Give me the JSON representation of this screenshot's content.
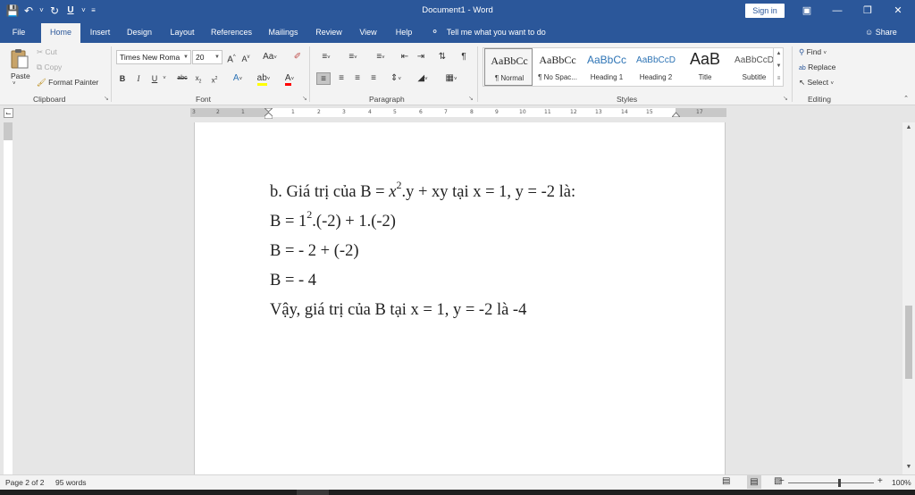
{
  "window": {
    "title": "Document1 - Word",
    "sign_in": "Sign in"
  },
  "tabs": [
    "File",
    "Home",
    "Insert",
    "Design",
    "Layout",
    "References",
    "Mailings",
    "Review",
    "View",
    "Help"
  ],
  "tell_me": "Tell me what you want to do",
  "share": "Share",
  "clipboard": {
    "paste": "Paste",
    "cut": "Cut",
    "copy": "Copy",
    "format_painter": "Format Painter",
    "label": "Clipboard"
  },
  "font": {
    "family": "Times New Roma",
    "size": "20",
    "label": "Font"
  },
  "paragraph": {
    "label": "Paragraph"
  },
  "styles": {
    "label": "Styles",
    "items": [
      {
        "sample": "AaBbCc",
        "name": "¶ Normal"
      },
      {
        "sample": "AaBbCc",
        "name": "¶ No Spac..."
      },
      {
        "sample": "AaBbCc",
        "name": "Heading 1"
      },
      {
        "sample": "AaBbCcD",
        "name": "Heading 2"
      },
      {
        "sample": "AaB",
        "name": "Title"
      },
      {
        "sample": "AaBbCcD",
        "name": "Subtitle"
      }
    ]
  },
  "editing": {
    "label": "Editing",
    "find": "Find",
    "replace": "Replace",
    "select": "Select"
  },
  "ruler": {
    "numbers": [
      "3",
      "2",
      "1",
      "1",
      "2",
      "3",
      "4",
      "5",
      "6",
      "7",
      "8",
      "9",
      "10",
      "11",
      "12",
      "13",
      "14",
      "15",
      "17"
    ]
  },
  "document": {
    "lines": [
      {
        "pre": "b. Giá trị của B = ",
        "math": "x",
        "sup": "2",
        "post": ".y + xy tại x = 1, y = -2 là:"
      },
      {
        "pre": "B = 1",
        "math": "",
        "sup": "2",
        "post": ".(-2) + 1.(-2)"
      },
      {
        "pre": "B = - 2 + (-2)",
        "math": "",
        "sup": "",
        "post": ""
      },
      {
        "pre": "B = - 4",
        "math": "",
        "sup": "",
        "post": ""
      },
      {
        "pre": "Vậy, giá trị của B tại x = 1, y = -2 là -4",
        "math": "",
        "sup": "",
        "post": ""
      }
    ]
  },
  "status": {
    "page": "Page 2 of 2",
    "words": "95 words",
    "zoom": "100%",
    "zoom_minus": "−",
    "zoom_plus": "+"
  }
}
